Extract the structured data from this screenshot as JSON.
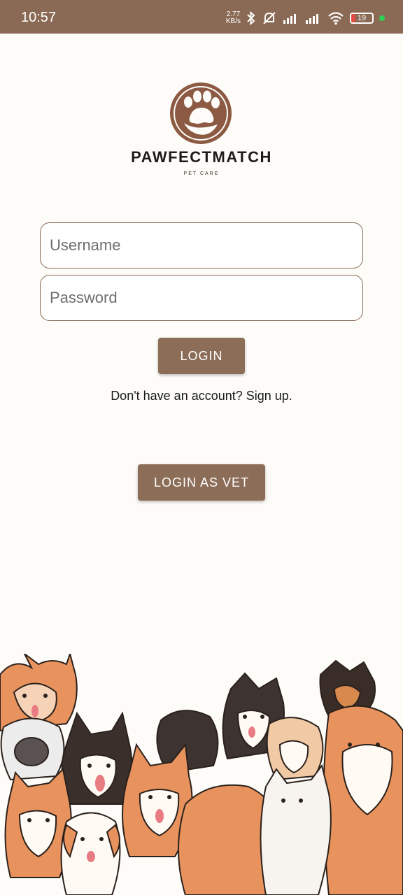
{
  "status_bar": {
    "time": "10:57",
    "network_speed": "2.77",
    "network_speed_unit": "KB/s",
    "battery_level": "19",
    "battery_fill_fraction": 0.19,
    "icons": [
      "bluetooth-icon",
      "mute-icon",
      "signal-icon",
      "signal-icon",
      "wifi-icon",
      "battery-icon",
      "status-dot"
    ]
  },
  "brand": {
    "name": "PAWFECTMATCH",
    "tagline": "PET CARE"
  },
  "login_form": {
    "username_placeholder": "Username",
    "password_placeholder": "Password",
    "login_label": "LOGIN",
    "signup_prompt": "Don't have an account? Sign up."
  },
  "vet_login": {
    "label": "LOGIN AS VET"
  },
  "colors": {
    "primary": "#8c6d58",
    "background": "#fdfcf8",
    "accent_dog": "#e8935e"
  }
}
